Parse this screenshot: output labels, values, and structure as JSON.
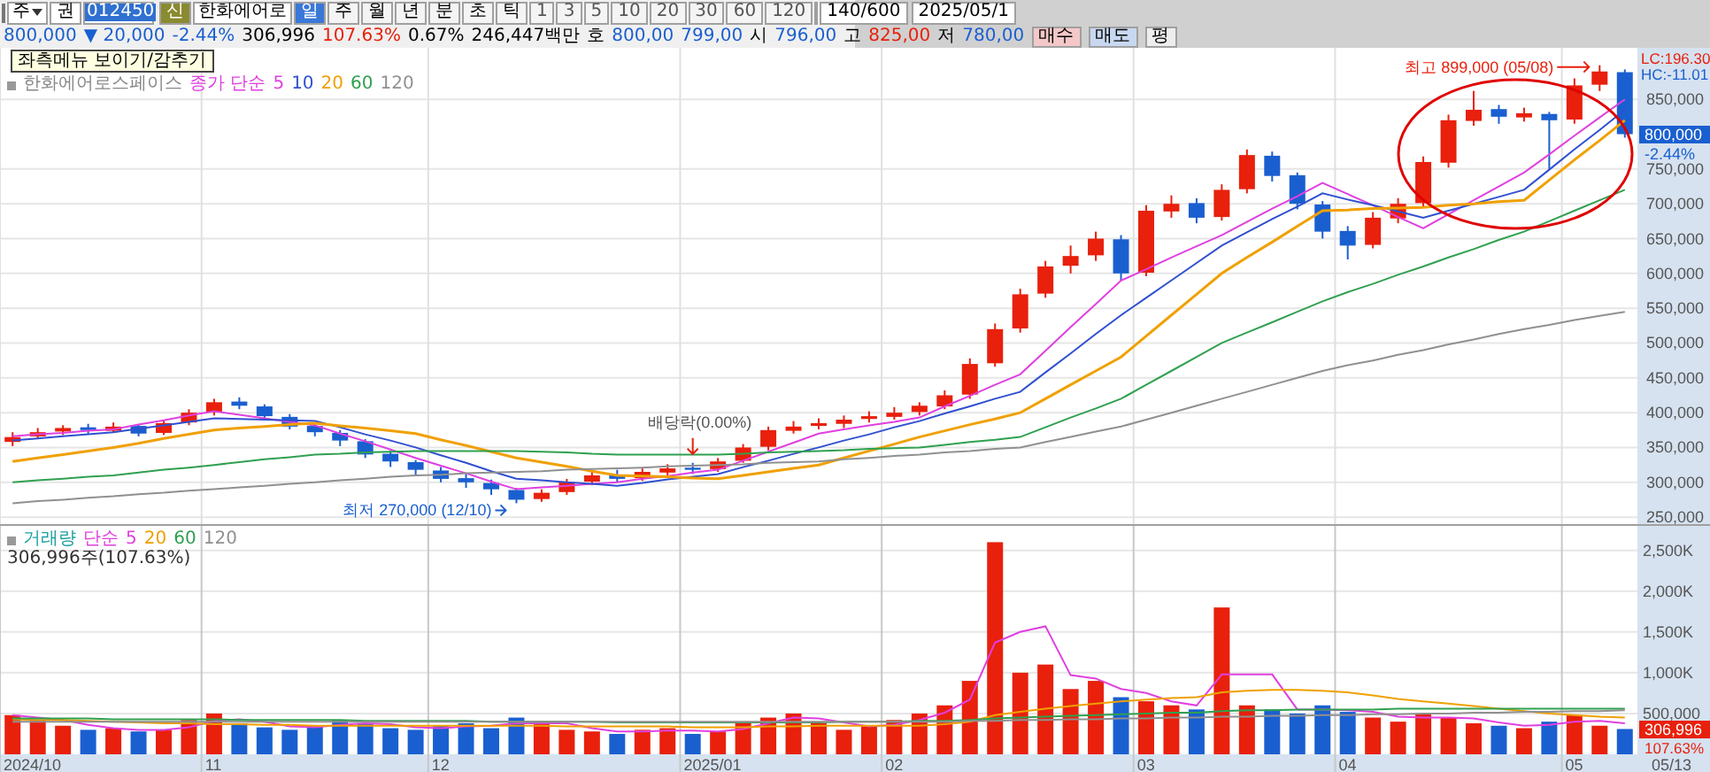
{
  "toolbar": {
    "market": "주",
    "type": "권",
    "code": "012450",
    "new_badge": "신",
    "name": "한화에어로",
    "periods": [
      {
        "label": "일",
        "selected": true
      },
      {
        "label": "주",
        "selected": false
      },
      {
        "label": "월",
        "selected": false
      },
      {
        "label": "년",
        "selected": false
      },
      {
        "label": "분",
        "selected": false
      },
      {
        "label": "초",
        "selected": false
      },
      {
        "label": "틱",
        "selected": false
      }
    ],
    "intervals": [
      {
        "label": "1",
        "selected": false
      },
      {
        "label": "3",
        "selected": false
      },
      {
        "label": "5",
        "selected": false
      },
      {
        "label": "10",
        "selected": false
      },
      {
        "label": "20",
        "selected": false
      },
      {
        "label": "30",
        "selected": false
      },
      {
        "label": "60",
        "selected": false
      },
      {
        "label": "120",
        "selected": false
      }
    ],
    "count": "140/600",
    "date": "2025/05/1"
  },
  "quote": {
    "price": "800,000",
    "change": "▼ 20,000",
    "rate": "-2.44%",
    "volume": "306,996",
    "volume_rate": "107.63%",
    "turnover": "0.67%",
    "amount": "246,447백만",
    "ask_label": "호",
    "ask": "800,00",
    "bid": "799,00",
    "open_label": "시",
    "open": "796,00",
    "high_label": "고",
    "high": "825,00",
    "low_label": "저",
    "low": "780,00",
    "buttons": [
      {
        "label": "매수",
        "kind": "buy"
      },
      {
        "label": "매도",
        "kind": "sell"
      },
      {
        "label": "평",
        "kind": "plain"
      }
    ]
  },
  "tooltip": "좌측메뉴 보이기/감추기",
  "price_legend": {
    "name": "한화에어로스페이스",
    "label": "종가 단순"
  },
  "price_axis": {
    "lc": "LC:196.30",
    "hc": "HC:-11.01",
    "current": "800,000",
    "change": "-2.44%"
  },
  "ex_dividend": "배당락(0.00%)",
  "price_chart": {
    "chart_data": {
      "type": "candlestick",
      "grid": true,
      "ylim": [
        240000,
        924000
      ],
      "yticks": [
        {
          "value": 250000,
          "label": "250,000"
        },
        {
          "value": 300000,
          "label": "300,000"
        },
        {
          "value": 350000,
          "label": "350,000"
        },
        {
          "value": 400000,
          "label": "400,000"
        },
        {
          "value": 450000,
          "label": "450,000"
        },
        {
          "value": 500000,
          "label": "500,000"
        },
        {
          "value": 550000,
          "label": "550,000"
        },
        {
          "value": 600000,
          "label": "600,000"
        },
        {
          "value": 650000,
          "label": "650,000"
        },
        {
          "value": 700000,
          "label": "700,000"
        },
        {
          "value": 750000,
          "label": "750,000"
        },
        {
          "value": 850000,
          "label": "850,000"
        }
      ],
      "ohlc": [
        [
          358000,
          372000,
          352000,
          365000
        ],
        [
          366000,
          378000,
          362000,
          372000
        ],
        [
          373000,
          382000,
          368000,
          378000
        ],
        [
          379000,
          384000,
          370000,
          375000
        ],
        [
          374000,
          386000,
          371000,
          380000
        ],
        [
          381000,
          383000,
          366000,
          370000
        ],
        [
          371000,
          390000,
          368000,
          385000
        ],
        [
          386000,
          405000,
          382000,
          400000
        ],
        [
          401000,
          420000,
          396000,
          415000
        ],
        [
          416000,
          422000,
          405000,
          410000
        ],
        [
          409000,
          412000,
          390000,
          395000
        ],
        [
          394000,
          398000,
          376000,
          380000
        ],
        [
          381000,
          385000,
          366000,
          372000
        ],
        [
          371000,
          375000,
          352000,
          360000
        ],
        [
          359000,
          362000,
          335000,
          340000
        ],
        [
          341000,
          345000,
          322000,
          330000
        ],
        [
          329000,
          332000,
          310000,
          318000
        ],
        [
          317000,
          322000,
          300000,
          305000
        ],
        [
          306000,
          312000,
          292000,
          300000
        ],
        [
          299000,
          304000,
          282000,
          290000
        ],
        [
          289000,
          292000,
          270000,
          275000
        ],
        [
          276000,
          290000,
          272000,
          285000
        ],
        [
          286000,
          305000,
          282000,
          300000
        ],
        [
          301000,
          316000,
          296000,
          310000
        ],
        [
          311000,
          318000,
          300000,
          305000
        ],
        [
          306000,
          320000,
          302000,
          315000
        ],
        [
          314000,
          326000,
          310000,
          320000
        ],
        [
          321000,
          328000,
          312000,
          318000
        ],
        [
          319000,
          335000,
          315000,
          330000
        ],
        [
          331000,
          355000,
          328000,
          350000
        ],
        [
          351000,
          380000,
          346000,
          375000
        ],
        [
          374000,
          388000,
          370000,
          380000
        ],
        [
          381000,
          392000,
          376000,
          385000
        ],
        [
          384000,
          396000,
          378000,
          390000
        ],
        [
          391000,
          402000,
          386000,
          395000
        ],
        [
          394000,
          408000,
          390000,
          400000
        ],
        [
          401000,
          415000,
          396000,
          410000
        ],
        [
          409000,
          432000,
          405000,
          425000
        ],
        [
          426000,
          478000,
          420000,
          470000
        ],
        [
          471000,
          528000,
          466000,
          520000
        ],
        [
          521000,
          578000,
          515000,
          570000
        ],
        [
          571000,
          618000,
          565000,
          610000
        ],
        [
          611000,
          640000,
          600000,
          625000
        ],
        [
          626000,
          660000,
          618000,
          650000
        ],
        [
          649000,
          655000,
          590000,
          600000
        ],
        [
          601000,
          698000,
          596000,
          690000
        ],
        [
          689000,
          712000,
          680000,
          700000
        ],
        [
          701000,
          708000,
          672000,
          680000
        ],
        [
          681000,
          728000,
          676000,
          720000
        ],
        [
          721000,
          778000,
          715000,
          770000
        ],
        [
          769000,
          775000,
          732000,
          740000
        ],
        [
          741000,
          745000,
          692000,
          700000
        ],
        [
          699000,
          704000,
          650000,
          660000
        ],
        [
          661000,
          668000,
          620000,
          640000
        ],
        [
          641000,
          688000,
          636000,
          680000
        ],
        [
          679000,
          708000,
          672000,
          700000
        ],
        [
          701000,
          768000,
          695000,
          760000
        ],
        [
          759000,
          828000,
          752000,
          820000
        ],
        [
          819000,
          862000,
          812000,
          835000
        ],
        [
          836000,
          842000,
          815000,
          825000
        ],
        [
          824000,
          838000,
          818000,
          830000
        ],
        [
          829000,
          832000,
          750000,
          820000
        ],
        [
          821000,
          880000,
          815000,
          870000
        ],
        [
          871000,
          899000,
          862000,
          890000
        ],
        [
          889000,
          893000,
          795000,
          800000
        ]
      ],
      "series": [
        {
          "name": "5",
          "color": "#e040e0",
          "type": "line",
          "values": [
            366000,
            369000,
            371000,
            374000,
            376000,
            383000,
            389000,
            396000,
            402000,
            397000,
            392000,
            387000,
            382000,
            370000,
            359000,
            347000,
            335000,
            324000,
            313000,
            301000,
            290000,
            293000,
            295000,
            298000,
            300000,
            305000,
            309000,
            314000,
            318000,
            331000,
            344000,
            357000,
            370000,
            376000,
            382000,
            387000,
            393000,
            409000,
            424000,
            440000,
            455000,
            489000,
            523000,
            556000,
            590000,
            606000,
            623000,
            639000,
            655000,
            674000,
            693000,
            711000,
            730000,
            714000,
            698000,
            681000,
            665000,
            685000,
            705000,
            725000,
            745000,
            771000,
            798000,
            824000,
            850000
          ]
        },
        {
          "name": "10",
          "color": "#3050d0",
          "type": "line",
          "values": [
            360000,
            363000,
            366000,
            369000,
            372000,
            377000,
            382000,
            387000,
            392000,
            391000,
            390000,
            389000,
            388000,
            379000,
            369000,
            360000,
            350000,
            339000,
            328000,
            316000,
            305000,
            303000,
            300000,
            298000,
            295000,
            299000,
            304000,
            308000,
            312000,
            322000,
            331000,
            341000,
            350000,
            360000,
            369000,
            379000,
            388000,
            399000,
            409000,
            420000,
            430000,
            458000,
            485000,
            513000,
            540000,
            565000,
            590000,
            615000,
            640000,
            659000,
            678000,
            696000,
            715000,
            706000,
            698000,
            689000,
            680000,
            690000,
            700000,
            710000,
            720000,
            749000,
            778000,
            806000,
            835000
          ]
        },
        {
          "name": "20",
          "color": "#f0a000",
          "type": "line",
          "values": [
            330000,
            335000,
            340000,
            345000,
            350000,
            356000,
            363000,
            369000,
            375000,
            378000,
            380000,
            383000,
            385000,
            381000,
            378000,
            374000,
            370000,
            361000,
            353000,
            344000,
            335000,
            329000,
            323000,
            316000,
            310000,
            309000,
            308000,
            306000,
            305000,
            310000,
            315000,
            320000,
            325000,
            335000,
            345000,
            355000,
            365000,
            374000,
            383000,
            391000,
            400000,
            420000,
            440000,
            460000,
            480000,
            510000,
            540000,
            570000,
            600000,
            623000,
            645000,
            668000,
            690000,
            691000,
            693000,
            694000,
            695000,
            698000,
            700000,
            703000,
            705000,
            734000,
            763000,
            791000,
            820000
          ]
        },
        {
          "name": "60",
          "color": "#30a050",
          "type": "line",
          "values": [
            300000,
            303000,
            305000,
            308000,
            310000,
            314000,
            318000,
            321000,
            325000,
            329000,
            333000,
            336000,
            340000,
            341000,
            343000,
            344000,
            345000,
            345000,
            345000,
            345000,
            345000,
            344000,
            343000,
            341000,
            340000,
            340000,
            340000,
            340000,
            340000,
            341000,
            343000,
            344000,
            345000,
            346000,
            348000,
            349000,
            350000,
            354000,
            358000,
            361000,
            365000,
            379000,
            393000,
            406000,
            420000,
            440000,
            460000,
            480000,
            500000,
            515000,
            530000,
            545000,
            560000,
            573000,
            585000,
            598000,
            610000,
            623000,
            635000,
            648000,
            660000,
            675000,
            690000,
            705000,
            720000
          ]
        },
        {
          "name": "120",
          "color": "#909090",
          "type": "line",
          "values": [
            270000,
            273000,
            275000,
            278000,
            280000,
            283000,
            285000,
            288000,
            290000,
            293000,
            295000,
            298000,
            300000,
            303000,
            305000,
            308000,
            310000,
            311000,
            313000,
            314000,
            315000,
            316000,
            318000,
            319000,
            320000,
            321000,
            323000,
            324000,
            325000,
            326000,
            328000,
            329000,
            330000,
            333000,
            335000,
            338000,
            340000,
            343000,
            345000,
            348000,
            350000,
            358000,
            365000,
            373000,
            380000,
            390000,
            400000,
            410000,
            420000,
            430000,
            440000,
            450000,
            460000,
            468000,
            475000,
            483000,
            490000,
            498000,
            505000,
            513000,
            520000,
            526000,
            533000,
            539000,
            545000
          ]
        }
      ],
      "annotations": [
        "최고 899,000 (05/08)",
        "최저 270,000 (12/10)"
      ]
    }
  },
  "volume_legend": {
    "name": "거래량",
    "label": "단순"
  },
  "volume_reading": "306,996주(107.63%)",
  "volume_axis": {
    "current": "306,996",
    "rate": "107.63%"
  },
  "date_axis": [
    "2024/10",
    "11",
    "12",
    "2025/01",
    "02",
    "03",
    "04",
    "05",
    "05/13"
  ],
  "volume_chart": {
    "chart_data": {
      "type": "bar",
      "grid": true,
      "ylim": [
        0,
        2800000
      ],
      "yticks": [
        {
          "value": 500000,
          "label": "500,000"
        },
        {
          "value": 1000000,
          "label": "1,000K"
        },
        {
          "value": 1500000,
          "label": "1,500K"
        },
        {
          "value": 2000000,
          "label": "2,000K"
        },
        {
          "value": 2500000,
          "label": "2,500K"
        }
      ],
      "series": [
        {
          "values": [
            480000,
            420000,
            350000,
            300000,
            320000,
            280000,
            300000,
            420000,
            500000,
            380000,
            330000,
            300000,
            350000,
            420000,
            380000,
            320000,
            300000,
            350000,
            380000,
            320000,
            450000,
            380000,
            300000,
            280000,
            250000,
            300000,
            320000,
            250000,
            280000,
            400000,
            450000,
            500000,
            380000,
            300000,
            350000,
            420000,
            500000,
            600000,
            900000,
            2600000,
            1000000,
            1100000,
            800000,
            900000,
            700000,
            650000,
            600000,
            550000,
            1800000,
            600000,
            550000,
            500000,
            600000,
            520000,
            450000,
            400000,
            500000,
            450000,
            380000,
            350000,
            320000,
            400000,
            480000,
            350000,
            310000
          ],
          "colors": [
            "#e8200c",
            "#e8200c",
            "#e8200c",
            "#1a5fd0",
            "#e8200c",
            "#1a5fd0",
            "#e8200c",
            "#e8200c",
            "#e8200c",
            "#1a5fd0",
            "#1a5fd0",
            "#1a5fd0",
            "#1a5fd0",
            "#1a5fd0",
            "#1a5fd0",
            "#1a5fd0",
            "#1a5fd0",
            "#1a5fd0",
            "#1a5fd0",
            "#1a5fd0",
            "#1a5fd0",
            "#e8200c",
            "#e8200c",
            "#e8200c",
            "#1a5fd0",
            "#e8200c",
            "#e8200c",
            "#1a5fd0",
            "#e8200c",
            "#e8200c",
            "#e8200c",
            "#e8200c",
            "#e8200c",
            "#e8200c",
            "#e8200c",
            "#e8200c",
            "#e8200c",
            "#e8200c",
            "#e8200c",
            "#e8200c",
            "#e8200c",
            "#e8200c",
            "#e8200c",
            "#e8200c",
            "#1a5fd0",
            "#e8200c",
            "#e8200c",
            "#1a5fd0",
            "#e8200c",
            "#e8200c",
            "#1a5fd0",
            "#1a5fd0",
            "#1a5fd0",
            "#1a5fd0",
            "#e8200c",
            "#e8200c",
            "#e8200c",
            "#e8200c",
            "#e8200c",
            "#1a5fd0",
            "#e8200c",
            "#1a5fd0",
            "#e8200c",
            "#e8200c",
            "#1a5fd0"
          ]
        },
        {
          "name": "5",
          "color": "#e040e0",
          "type": "line",
          "values": [
            480000,
            450000,
            420000,
            360000,
            320000,
            300000,
            300000,
            330000,
            410000,
            430000,
            400000,
            340000,
            330000,
            360000,
            380000,
            370000,
            330000,
            320000,
            340000,
            350000,
            380000,
            380000,
            380000,
            320000,
            280000,
            280000,
            290000,
            290000,
            280000,
            310000,
            380000,
            450000,
            440000,
            390000,
            340000,
            360000,
            420000,
            510000,
            670000,
            1370000,
            1500000,
            1570000,
            970000,
            930000,
            800000,
            750000,
            650000,
            600000,
            980000,
            980000,
            980000,
            550000,
            550000,
            540000,
            520000,
            460000,
            450000,
            450000,
            440000,
            390000,
            350000,
            360000,
            400000,
            410000,
            380000
          ]
        },
        {
          "name": "20",
          "color": "#f0a000",
          "type": "line",
          "values": [
            430000,
            420000,
            420000,
            410000,
            400000,
            390000,
            380000,
            380000,
            370000,
            370000,
            360000,
            360000,
            350000,
            350000,
            350000,
            350000,
            350000,
            350000,
            350000,
            350000,
            350000,
            350000,
            340000,
            340000,
            340000,
            340000,
            340000,
            330000,
            330000,
            330000,
            340000,
            340000,
            350000,
            350000,
            350000,
            350000,
            350000,
            370000,
            400000,
            480000,
            520000,
            560000,
            590000,
            620000,
            650000,
            670000,
            690000,
            700000,
            760000,
            780000,
            790000,
            790000,
            780000,
            760000,
            720000,
            680000,
            650000,
            620000,
            590000,
            560000,
            530000,
            500000,
            480000,
            460000,
            450000
          ]
        },
        {
          "name": "60",
          "color": "#30a050",
          "type": "line",
          "values": [
            440000,
            440000,
            440000,
            440000,
            430000,
            430000,
            430000,
            430000,
            430000,
            420000,
            420000,
            420000,
            420000,
            420000,
            410000,
            410000,
            410000,
            410000,
            410000,
            400000,
            400000,
            400000,
            400000,
            400000,
            390000,
            390000,
            390000,
            390000,
            390000,
            390000,
            390000,
            390000,
            390000,
            400000,
            400000,
            400000,
            410000,
            410000,
            420000,
            440000,
            450000,
            460000,
            470000,
            480000,
            490000,
            500000,
            510000,
            510000,
            530000,
            540000,
            540000,
            550000,
            550000,
            550000,
            550000,
            560000,
            560000,
            560000,
            560000,
            560000,
            560000,
            560000,
            560000,
            560000,
            560000
          ]
        },
        {
          "name": "120",
          "color": "#909090",
          "type": "line",
          "values": [
            400000,
            400000,
            400000,
            400000,
            400000,
            400000,
            400000,
            400000,
            400000,
            400000,
            400000,
            400000,
            400000,
            400000,
            400000,
            400000,
            400000,
            400000,
            400000,
            400000,
            400000,
            400000,
            400000,
            400000,
            400000,
            400000,
            400000,
            400000,
            400000,
            400000,
            400000,
            400000,
            400000,
            400000,
            400000,
            400000,
            400000,
            400000,
            410000,
            410000,
            420000,
            420000,
            430000,
            430000,
            440000,
            440000,
            450000,
            450000,
            460000,
            460000,
            470000,
            470000,
            480000,
            480000,
            490000,
            490000,
            500000,
            500000,
            510000,
            510000,
            520000,
            520000,
            530000,
            530000,
            540000
          ]
        }
      ]
    }
  }
}
